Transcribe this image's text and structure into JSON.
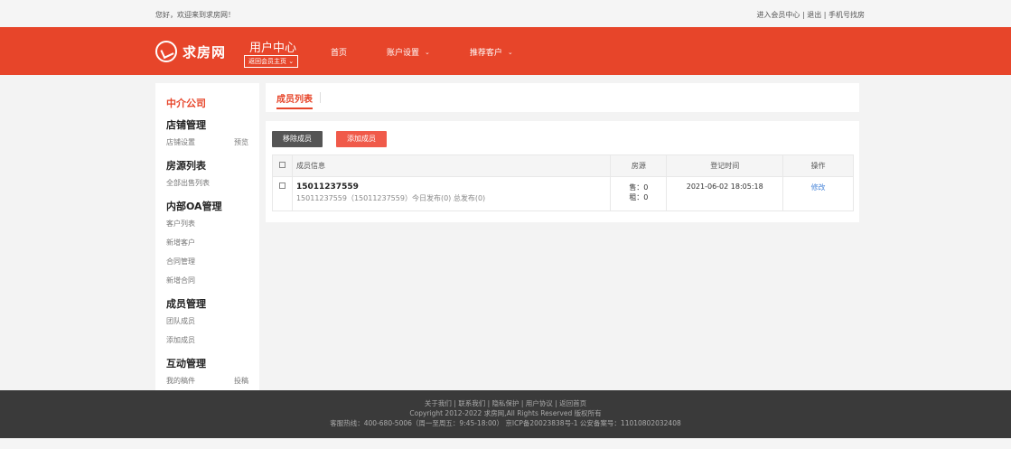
{
  "topbar": {
    "greeting": "您好，欢迎来到求房网！",
    "links": "进入会员中心 | 退出 | 手机号找房"
  },
  "header": {
    "brand": "求房网",
    "title": "用户中心",
    "back_home": "返回会员主页",
    "nav": [
      {
        "label": "首页",
        "chevron": false
      },
      {
        "label": "账户设置",
        "chevron": true
      },
      {
        "label": "推荐客户",
        "chevron": true
      }
    ]
  },
  "sidebar": {
    "company": "中介公司",
    "sections": [
      {
        "title": "店铺管理",
        "links": [
          {
            "label": "店铺设置",
            "extra": "预览"
          }
        ]
      },
      {
        "title": "房源列表",
        "links": [
          {
            "label": "全部出售列表",
            "extra": ""
          }
        ]
      },
      {
        "title": "内部OA管理",
        "links": [
          {
            "label": "客户列表",
            "extra": ""
          },
          {
            "label": "新增客户",
            "extra": ""
          },
          {
            "label": "合同管理",
            "extra": ""
          },
          {
            "label": "新增合同",
            "extra": ""
          }
        ]
      },
      {
        "title": "成员管理",
        "links": [
          {
            "label": "团队成员",
            "extra": ""
          },
          {
            "label": "添加成员",
            "extra": ""
          }
        ]
      },
      {
        "title": "互动管理",
        "links": [
          {
            "label": "我的稿件",
            "extra": "投稿"
          }
        ]
      }
    ]
  },
  "main": {
    "tab": "成员列表",
    "remove_btn": "移除成员",
    "add_btn": "添加成员",
    "columns": {
      "info": "成员信息",
      "house": "房源",
      "time": "登记时间",
      "op": "操作"
    },
    "rows": [
      {
        "name": "15011237559",
        "sub": "15011237559（15011237559）今日发布(0) 总发布(0)",
        "sale": "售：0",
        "rent": "租：0",
        "time": "2021-06-02 18:05:18",
        "op": "修改"
      }
    ]
  },
  "footer": {
    "links": "关于我们 | 联系我们 | 隐私保护 | 用户协议 | 返回首页",
    "copyright": "Copyright 2012-2022 求房网,All Rights Reserved 版权所有",
    "contact": "客服热线：400-680-5006（周一至周五：9:45-18:00） 京ICP备20023838号-1 公安备案号：11010802032408"
  },
  "colors": {
    "brand": "#e7452a",
    "add_button": "#f05a4a",
    "link": "#4a86d9"
  }
}
